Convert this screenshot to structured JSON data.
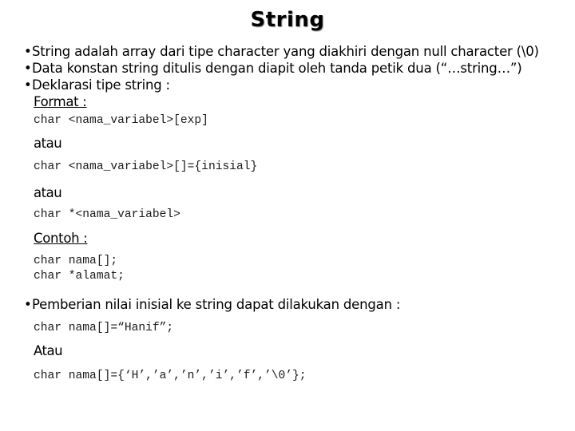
{
  "slide": {
    "title": "String",
    "bullets": [
      "String adalah array dari tipe character yang diakhiri dengan null character (\\0)",
      "Data konstan string ditulis dengan diapit oleh tanda petik dua (“…string…”)",
      "Deklarasi tipe string :"
    ],
    "bullet_glyph": "•",
    "format_heading": "Format :",
    "format_lines": [
      "char <nama_variabel>[exp]",
      "atau",
      "char <nama_variabel>[]={inisial}",
      "atau",
      "char *<nama_variabel>"
    ],
    "example_heading": "Contoh :",
    "example_lines": [
      "char nama[];",
      "char *alamat;"
    ],
    "init_bullet": "Pemberian nilai inisial ke string dapat dilakukan dengan :",
    "init_lines": [
      "char nama[]=“Hanif”;",
      "Atau",
      "char nama[]={‘H’,’a’,’n’,’i’,’f’,’\\0’};"
    ]
  }
}
